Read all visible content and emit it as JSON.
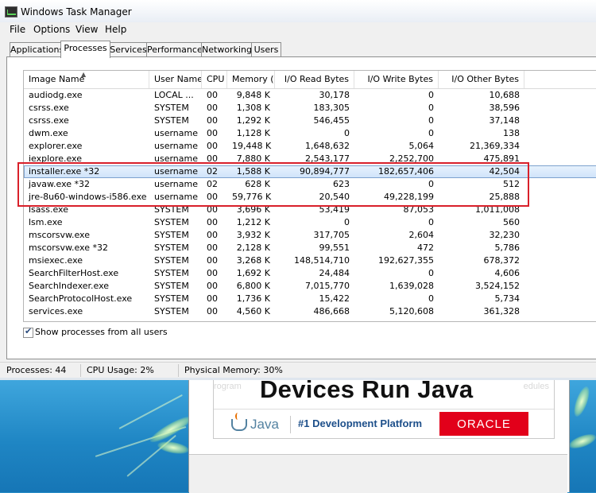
{
  "window": {
    "title": "Windows Task Manager"
  },
  "menu": [
    "File",
    "Options",
    "View",
    "Help"
  ],
  "tabs": [
    "Applications",
    "Processes",
    "Services",
    "Performance",
    "Networking",
    "Users"
  ],
  "active_tab": "Processes",
  "columns": [
    "Image Name",
    "User Name",
    "CPU",
    "Memory (...",
    "I/O Read Bytes",
    "I/O Write Bytes",
    "I/O Other Bytes"
  ],
  "processes": [
    {
      "name": "audiodg.exe",
      "user": "LOCAL ...",
      "cpu": "00",
      "mem": "9,848 K",
      "read": "30,178",
      "write": "0",
      "other": "10,688"
    },
    {
      "name": "csrss.exe",
      "user": "SYSTEM",
      "cpu": "00",
      "mem": "1,308 K",
      "read": "183,305",
      "write": "0",
      "other": "38,596"
    },
    {
      "name": "csrss.exe",
      "user": "SYSTEM",
      "cpu": "00",
      "mem": "1,292 K",
      "read": "546,455",
      "write": "0",
      "other": "37,148"
    },
    {
      "name": "dwm.exe",
      "user": "username",
      "cpu": "00",
      "mem": "1,128 K",
      "read": "0",
      "write": "0",
      "other": "138"
    },
    {
      "name": "explorer.exe",
      "user": "username",
      "cpu": "00",
      "mem": "19,448 K",
      "read": "1,648,632",
      "write": "5,064",
      "other": "21,369,334"
    },
    {
      "name": "iexplore.exe",
      "user": "username",
      "cpu": "00",
      "mem": "7,880 K",
      "read": "2,543,177",
      "write": "2,252,700",
      "other": "475,891"
    },
    {
      "name": "installer.exe *32",
      "user": "username",
      "cpu": "02",
      "mem": "1,588 K",
      "read": "90,894,777",
      "write": "182,657,406",
      "other": "42,504"
    },
    {
      "name": "javaw.exe *32",
      "user": "username",
      "cpu": "02",
      "mem": "628 K",
      "read": "623",
      "write": "0",
      "other": "512"
    },
    {
      "name": "jre-8u60-windows-i586.exe *32",
      "user": "username",
      "cpu": "00",
      "mem": "59,776 K",
      "read": "20,540",
      "write": "49,228,199",
      "other": "25,888"
    },
    {
      "name": "lsass.exe",
      "user": "SYSTEM",
      "cpu": "00",
      "mem": "3,696 K",
      "read": "53,419",
      "write": "87,053",
      "other": "1,011,008"
    },
    {
      "name": "lsm.exe",
      "user": "SYSTEM",
      "cpu": "00",
      "mem": "1,212 K",
      "read": "0",
      "write": "0",
      "other": "560"
    },
    {
      "name": "mscorsvw.exe",
      "user": "SYSTEM",
      "cpu": "00",
      "mem": "3,932 K",
      "read": "317,705",
      "write": "2,604",
      "other": "32,230"
    },
    {
      "name": "mscorsvw.exe *32",
      "user": "SYSTEM",
      "cpu": "00",
      "mem": "2,128 K",
      "read": "99,551",
      "write": "472",
      "other": "5,786"
    },
    {
      "name": "msiexec.exe",
      "user": "SYSTEM",
      "cpu": "00",
      "mem": "3,268 K",
      "read": "148,514,710",
      "write": "192,627,355",
      "other": "678,372"
    },
    {
      "name": "SearchFilterHost.exe",
      "user": "SYSTEM",
      "cpu": "00",
      "mem": "1,692 K",
      "read": "24,484",
      "write": "0",
      "other": "4,606"
    },
    {
      "name": "SearchIndexer.exe",
      "user": "SYSTEM",
      "cpu": "00",
      "mem": "6,800 K",
      "read": "7,015,770",
      "write": "1,639,028",
      "other": "3,524,152"
    },
    {
      "name": "SearchProtocolHost.exe",
      "user": "SYSTEM",
      "cpu": "00",
      "mem": "1,736 K",
      "read": "15,422",
      "write": "0",
      "other": "5,734"
    },
    {
      "name": "services.exe",
      "user": "SYSTEM",
      "cpu": "00",
      "mem": "4,560 K",
      "read": "486,668",
      "write": "5,120,608",
      "other": "361,328"
    }
  ],
  "selected_process": "installer.exe *32",
  "show_all_label": "Show processes from all users",
  "show_all_checked": true,
  "status": {
    "processes": "Processes: 44",
    "cpu": "CPU Usage: 2%",
    "memory": "Physical Memory: 30%"
  },
  "ad": {
    "faint_left": "rogram",
    "faint_right": "edules",
    "headline": "Devices Run Java",
    "java_logo_text": "Java",
    "tagline": "#1 Development Platform",
    "oracle_text": "ORACLE"
  },
  "colors": {
    "highlight_box": "#d9202a",
    "oracle_red": "#e2001a",
    "java_blue": "#5382a1"
  }
}
